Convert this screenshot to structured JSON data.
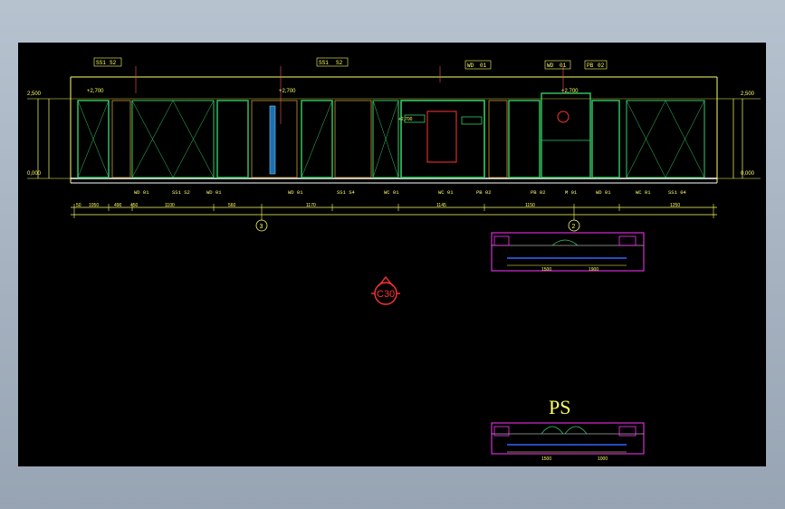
{
  "drawing": {
    "elevation_levels": {
      "top_left": "2,500",
      "top_right": "2,500",
      "bottom_left": "0,000",
      "bottom_right": "0,000",
      "opening_heights": [
        "+2,700",
        "+2,700",
        "+2,700",
        "+2,700"
      ]
    },
    "top_tags": [
      "SS1",
      "S2",
      "SS1",
      "S2",
      "WD",
      "01",
      "WD",
      "01",
      "PB",
      "02"
    ],
    "bottom_tags": [
      "WD 01",
      "SS1 S2",
      "WD 01",
      "WD 01",
      "SS1 S4",
      "WC 01",
      "WC 01",
      "PB 02",
      "PB 02",
      "M 01",
      "WD 01",
      "WC 01",
      "SS1 04"
    ],
    "grid_markers": [
      "3",
      "2"
    ],
    "dimension_values": [
      "50",
      "1050",
      "490",
      "450",
      "1100",
      "560",
      "1170",
      "1145",
      "1150",
      "1250"
    ],
    "section_symbol": "C30",
    "plan_label": "PS",
    "plan_dims_upper": [
      "1500",
      "1900"
    ],
    "plan_dims_lower": [
      "1500",
      "1000"
    ]
  }
}
